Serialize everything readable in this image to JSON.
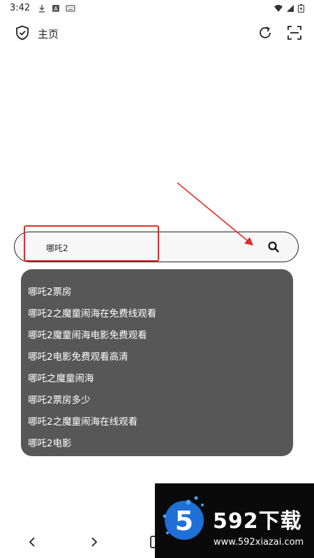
{
  "status_bar": {
    "time": "3:42",
    "icons": [
      "download-icon",
      "a-icon",
      "keyboard-icon",
      "wifi-icon",
      "signal-icon",
      "battery-icon"
    ]
  },
  "header": {
    "title": "主页",
    "icons": [
      "shield-check-icon",
      "refresh-icon",
      "scan-icon"
    ]
  },
  "search": {
    "value": "哪吒2",
    "icon": "search-icon"
  },
  "suggestions": [
    "哪吒2票房",
    "哪吒2之魔童闹海在免费线观看",
    "哪吒2魔童闹海电影免费观看",
    "哪吒2电影免费观看高清",
    "哪吒之魔童闹海",
    "哪吒2票房多少",
    "哪吒2之魔童闹海在线观看",
    "哪吒2电影"
  ],
  "bottom_nav": {
    "icons": [
      "back-icon",
      "forward-icon",
      "tabs-icon"
    ]
  },
  "watermark": {
    "brand": "592下载",
    "url": "www.592xiazai.com",
    "logo_digit": "5"
  },
  "colors": {
    "suggestion_panel": "#575757",
    "annotation_red": "#e02a2a"
  }
}
